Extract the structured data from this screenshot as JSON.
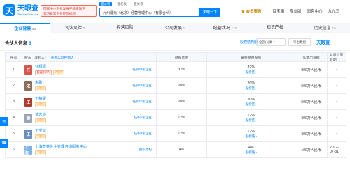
{
  "header": {
    "logo_mark": "天",
    "logo_cn": "天眼查",
    "logo_en": "TianYanCha.com",
    "promo_line1": "国家中小企业发展子基金旗下",
    "promo_line2": "官方备案企业征信机构",
    "search_tabs": [
      "查公司",
      "查老板",
      "查关系"
    ],
    "search_value": "九州疆元（北京）经营管理中心（有限合伙）",
    "search_button": "天眼一下",
    "nav": {
      "vip": "会员服务",
      "app": "百宝箱",
      "pro": "专业版",
      "messages": "消息中心",
      "user": "九九三"
    }
  },
  "tabs": [
    {
      "label": "企业背景",
      "count": "34",
      "active": true
    },
    {
      "label": "司法风险",
      "count": "0",
      "active": false
    },
    {
      "label": "经营风险",
      "count": "",
      "active": false
    },
    {
      "label": "公司发展",
      "count": "1",
      "active": false
    },
    {
      "label": "经营状况",
      "count": "122",
      "active": false
    },
    {
      "label": "知识产权",
      "count": "",
      "active": false
    },
    {
      "label": "历史信息",
      "count": "16",
      "active": false
    }
  ],
  "section": {
    "title": "合伙人信息",
    "count": "6",
    "link": "股权结构图",
    "filter": "全部(6)类 ▾",
    "button": "导出数据",
    "brand": "天眼查"
  },
  "table": {
    "headers": [
      "序号",
      "股东（发起人）",
      "持股比例",
      "最终受益股份",
      "认缴出资额",
      "认缴出资日期"
    ],
    "header_hint": "查看实际控制人",
    "rows": [
      {
        "no": "1",
        "name": "任辉辉",
        "tags": [
          {
            "text": "普通合伙人",
            "color": "red"
          },
          {
            "text": "大股东",
            "color": "orange"
          }
        ],
        "link": "任职38家企业 ›",
        "ratio": "32%",
        "benefit": "32%",
        "track": "股权链 ›",
        "amount": "800万人民币",
        "date": "-",
        "avatar_color": "#d9534f",
        "avatar_char": "任"
      },
      {
        "no": "2",
        "name": "宋歌",
        "tags": [
          {
            "text": "大股东",
            "color": "orange"
          }
        ],
        "link": "任职20家企业 ›",
        "ratio": "20%",
        "benefit": "20%",
        "track": "股权链 ›",
        "amount": "500万人民币",
        "date": "-",
        "avatar_color": "#8a6d5a",
        "avatar_char": "宋"
      },
      {
        "no": "3",
        "name": "王静雯",
        "tags": [
          {
            "text": "大股东",
            "color": "orange"
          }
        ],
        "link": "任职11家企业 ›",
        "ratio": "20%",
        "benefit": "20%",
        "track": "股权链 ›",
        "amount": "500万人民币",
        "date": "-",
        "avatar_color": "#b03a2e",
        "avatar_char": "王"
      },
      {
        "no": "4",
        "name": "黄志迪",
        "tags": [
          {
            "text": "大股东",
            "color": "orange"
          }
        ],
        "link": "任职1家企业 ›",
        "ratio": "12%",
        "benefit": "12%",
        "track": "股权链 ›",
        "amount": "300万人民币",
        "date": "-",
        "avatar_color": "#9aa6b8",
        "avatar_char": "黄"
      },
      {
        "no": "5",
        "name": "王宝铉",
        "tags": [
          {
            "text": "大股东",
            "color": "orange"
          }
        ],
        "link": "任职3家企业 ›",
        "ratio": "12%",
        "benefit": "12%",
        "track": "股权链 ›",
        "amount": "300万人民币",
        "date": "-",
        "avatar_color": "#6c8ebf",
        "avatar_char": "王"
      },
      {
        "no": "6",
        "name": "上海营娄企业管理咨询服务中心",
        "tags": [
          {
            "text": "大股东",
            "color": "orange"
          }
        ],
        "link": "股权结构 ›",
        "ratio": "4%",
        "benefit": "4%",
        "track": "股权链 ›",
        "amount": "100万人民币",
        "date": "2012-07-31",
        "avatar_color": "#7fb3e8",
        "avatar_char": "上海"
      }
    ]
  }
}
